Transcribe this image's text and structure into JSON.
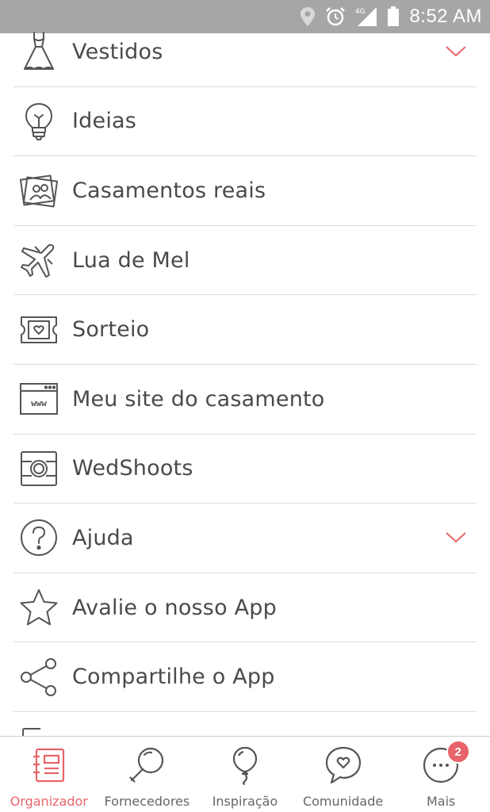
{
  "status_bar": {
    "time": "8:52 AM",
    "network": "4G",
    "icons": [
      "location-icon",
      "alarm-icon",
      "signal-icon",
      "battery-icon"
    ]
  },
  "menu": {
    "items": [
      {
        "label": "Vestidos",
        "icon": "dress-icon",
        "expandable": true
      },
      {
        "label": "Ideias",
        "icon": "lightbulb-icon",
        "expandable": false
      },
      {
        "label": "Casamentos reais",
        "icon": "photos-icon",
        "expandable": false
      },
      {
        "label": "Lua de Mel",
        "icon": "airplane-icon",
        "expandable": false
      },
      {
        "label": "Sorteio",
        "icon": "ticket-icon",
        "expandable": false
      },
      {
        "label": "Meu site do casamento",
        "icon": "website-icon",
        "expandable": false
      },
      {
        "label": "WedShoots",
        "icon": "camera-icon",
        "expandable": false
      },
      {
        "label": "Ajuda",
        "icon": "help-icon",
        "expandable": true
      },
      {
        "label": "Avalie o nosso App",
        "icon": "star-icon",
        "expandable": false
      },
      {
        "label": "Compartilhe o App",
        "icon": "share-icon",
        "expandable": false
      }
    ]
  },
  "bottom_nav": {
    "items": [
      {
        "label": "Organizador",
        "icon": "notebook-icon",
        "active": true
      },
      {
        "label": "Fornecedores",
        "icon": "magnifier-icon",
        "active": false
      },
      {
        "label": "Inspiração",
        "icon": "balloon-icon",
        "active": false
      },
      {
        "label": "Comunidade",
        "icon": "chat-heart-icon",
        "active": false
      },
      {
        "label": "Mais",
        "icon": "more-icon",
        "active": false,
        "badge": "2"
      }
    ]
  },
  "colors": {
    "accent": "#e8646a",
    "text": "#4a4a4a",
    "icon_stroke": "#555555",
    "divider": "#dcdcdc",
    "status_bar": "#a6a6a6"
  }
}
